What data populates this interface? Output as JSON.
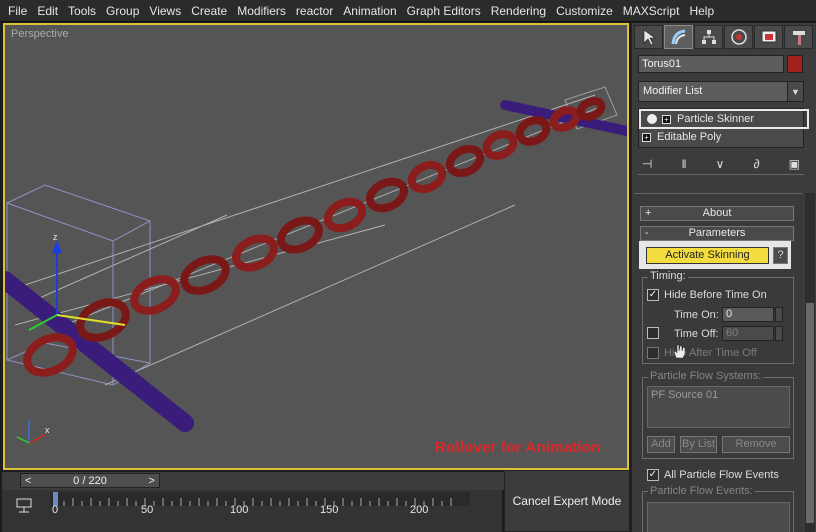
{
  "menu": {
    "items": [
      "File",
      "Edit",
      "Tools",
      "Group",
      "Views",
      "Create",
      "Modifiers",
      "reactor",
      "Animation",
      "Graph Editors",
      "Rendering",
      "Customize",
      "MAXScript",
      "Help"
    ]
  },
  "viewport": {
    "label": "Perspective",
    "rollover_text": "Rollover for Animation",
    "axis_z": "z",
    "axis_x": "x",
    "colors": {
      "border": "#d9c334",
      "chain": "#8c1d1d",
      "rod": "#3a1d7a",
      "overlay": "#e02626"
    }
  },
  "command_panel": {
    "tab_icons": [
      "arrow-create-icon",
      "bend-modify-icon",
      "hierarchy-icon",
      "motion-icon",
      "display-icon",
      "utilities-hammer-icon"
    ],
    "object_name": "Torus01",
    "object_color": "#a0201c",
    "modifier_list_label": "Modifier List",
    "stack": {
      "item1": "Particle Skinner",
      "item2": "Editable Poly"
    },
    "rollouts": {
      "about_label": "About",
      "about_sign": "+",
      "parameters_label": "Parameters",
      "parameters_sign": "-",
      "activate_btn": "Activate Skinning",
      "help_btn": "?",
      "timing_label": "Timing:",
      "hide_before": "Hide Before Time On",
      "time_on_label": "Time On:",
      "time_on_value": "0",
      "time_off_label": "Time Off:",
      "time_off_value": "60",
      "hide_after": "Hide After Time Off",
      "pf_systems_label": "Particle Flow Systems:",
      "pf_source": "PF Source 01",
      "add_btn": "Add",
      "bylist_btn": "By List",
      "remove_btn": "Remove",
      "all_pf_events": "All Particle Flow Events",
      "pf_events_label": "Particle Flow Events:"
    }
  },
  "timeline": {
    "slider_text": "0 / 220",
    "prev": "<",
    "next": ">",
    "ticks": [
      "0",
      "50",
      "100",
      "150",
      "200"
    ]
  },
  "expert_mode_btn": "Cancel Expert Mode"
}
